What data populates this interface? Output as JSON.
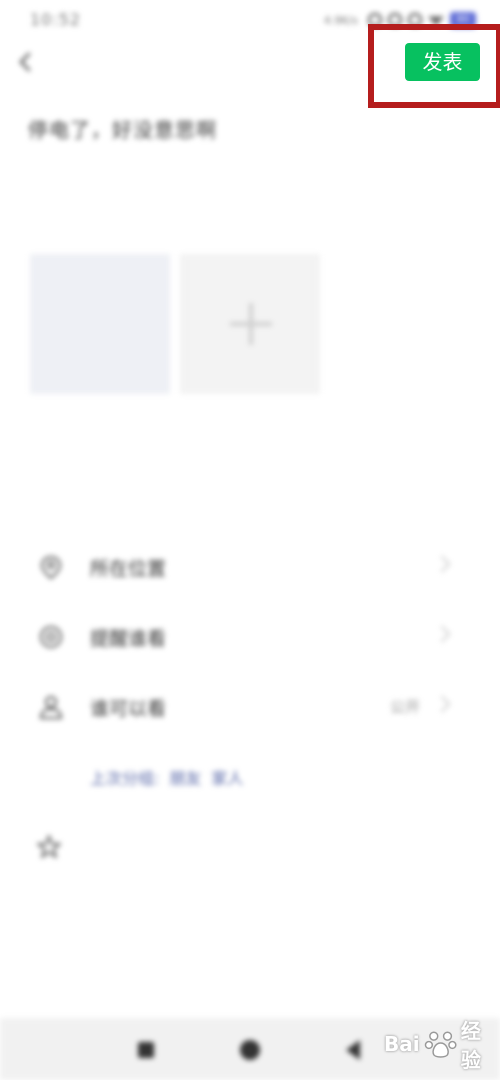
{
  "status_bar": {
    "time": "10:52",
    "network_speed": "4.9K/s",
    "battery": "80"
  },
  "header": {
    "publish_label": "发表"
  },
  "post": {
    "text": "停电了，好没意思啊"
  },
  "options": [
    {
      "label": "所在位置",
      "value": "",
      "icon": "location-icon"
    },
    {
      "label": "提醒谁看",
      "value": "",
      "icon": "at-icon"
    },
    {
      "label": "谁可以看",
      "value": "公开",
      "icon": "person-icon"
    }
  ],
  "hint": {
    "prefix": "上次分组:",
    "groups": [
      "朋友",
      "家人"
    ]
  },
  "watermark": {
    "text": "Bai",
    "suffix": "经验"
  },
  "colors": {
    "accent": "#07c160",
    "highlight": "#b51d1d",
    "link": "#5867a8"
  }
}
